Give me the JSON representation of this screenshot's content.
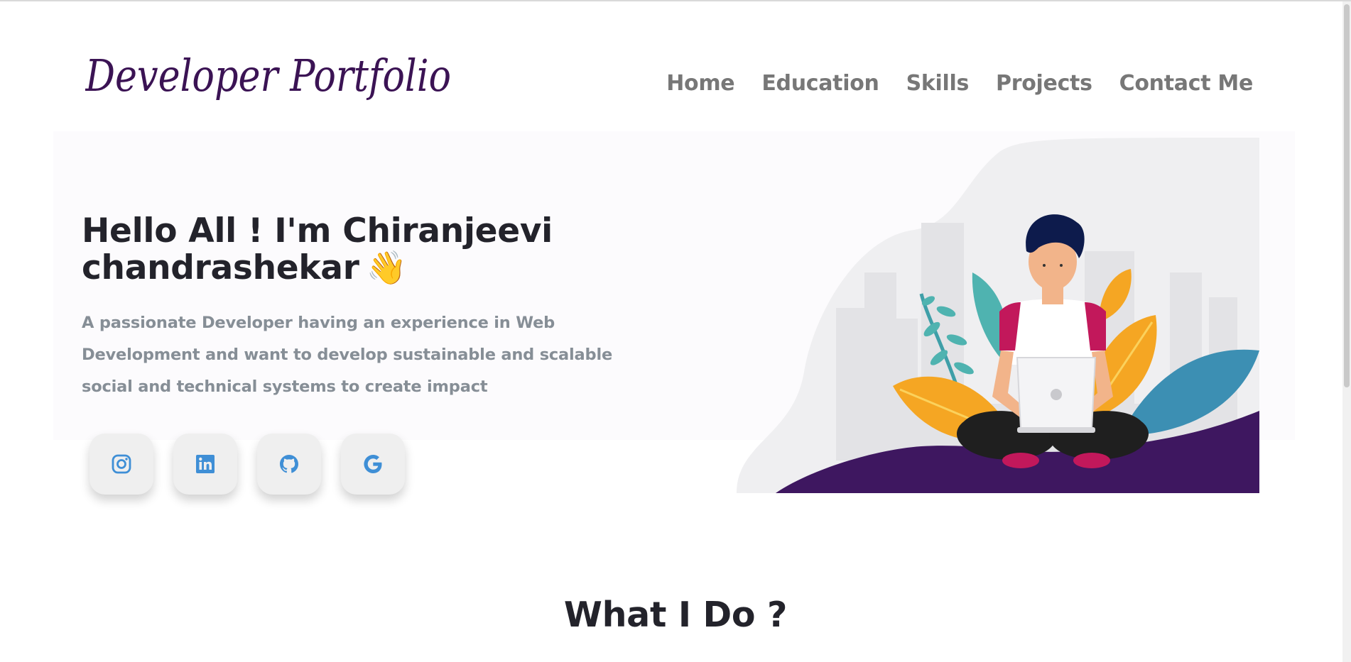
{
  "header": {
    "logo_text": "Developer Portfolio",
    "nav": [
      "Home",
      "Education",
      "Skills",
      "Projects",
      "Contact Me"
    ]
  },
  "hero": {
    "title_line1": "Hello All ! I'm Chiranjeevi",
    "title_line2": "chandrashekar",
    "wave_emoji": "👋",
    "subtitle": "A passionate Developer having an experience in Web Development and want to develop sustainable and scalable social and technical systems to create impact",
    "socials": [
      {
        "icon": "instagram-icon"
      },
      {
        "icon": "linkedin-icon"
      },
      {
        "icon": "github-icon"
      },
      {
        "icon": "google-icon"
      }
    ]
  },
  "section": {
    "title": "What I Do ?"
  },
  "colors": {
    "accent_icon": "#3f8fd6",
    "logo": "#3b1354",
    "nav_text": "#777777",
    "hill_purple": "#3e1760"
  }
}
